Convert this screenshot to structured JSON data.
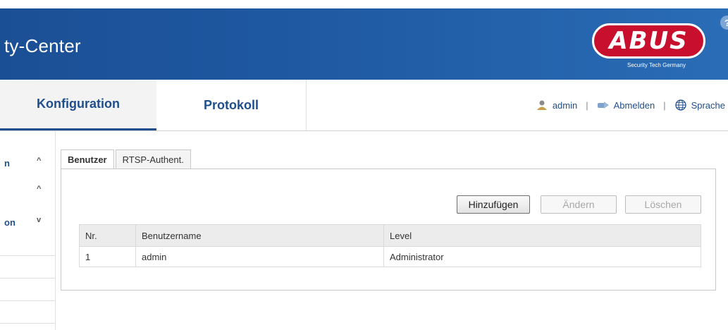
{
  "header": {
    "title": "ty-Center",
    "logo_text": "ABUS",
    "logo_tagline": "Security Tech Germany",
    "help_symbol": "?"
  },
  "nav": {
    "tabs": [
      {
        "label": "Konfiguration",
        "active": true
      },
      {
        "label": "Protokoll",
        "active": false
      }
    ],
    "user": "admin",
    "separator": "|",
    "logout": "Abmelden",
    "language": "Sprache"
  },
  "sidebar": {
    "items": [
      {
        "label": "n",
        "chevron": "^"
      },
      {
        "label": "",
        "chevron": "^"
      },
      {
        "label": "on",
        "chevron": "v"
      }
    ]
  },
  "tabs": [
    {
      "label": "Benutzer",
      "active": true
    },
    {
      "label": "RTSP-Authent.",
      "active": false
    }
  ],
  "buttons": {
    "add": "Hinzufügen",
    "edit": "Ändern",
    "delete": "Löschen"
  },
  "table": {
    "columns": [
      "Nr.",
      "Benutzername",
      "Level"
    ],
    "rows": [
      [
        "1",
        "admin",
        "Administrator"
      ]
    ]
  },
  "colors": {
    "header_blue": "#1f5aa3",
    "nav_text": "#1f4e8c",
    "logo_red": "#c8102e"
  },
  "icons": [
    "help-icon",
    "user-icon",
    "logout-icon",
    "globe-icon",
    "chevron-up-icon",
    "chevron-down-icon"
  ]
}
